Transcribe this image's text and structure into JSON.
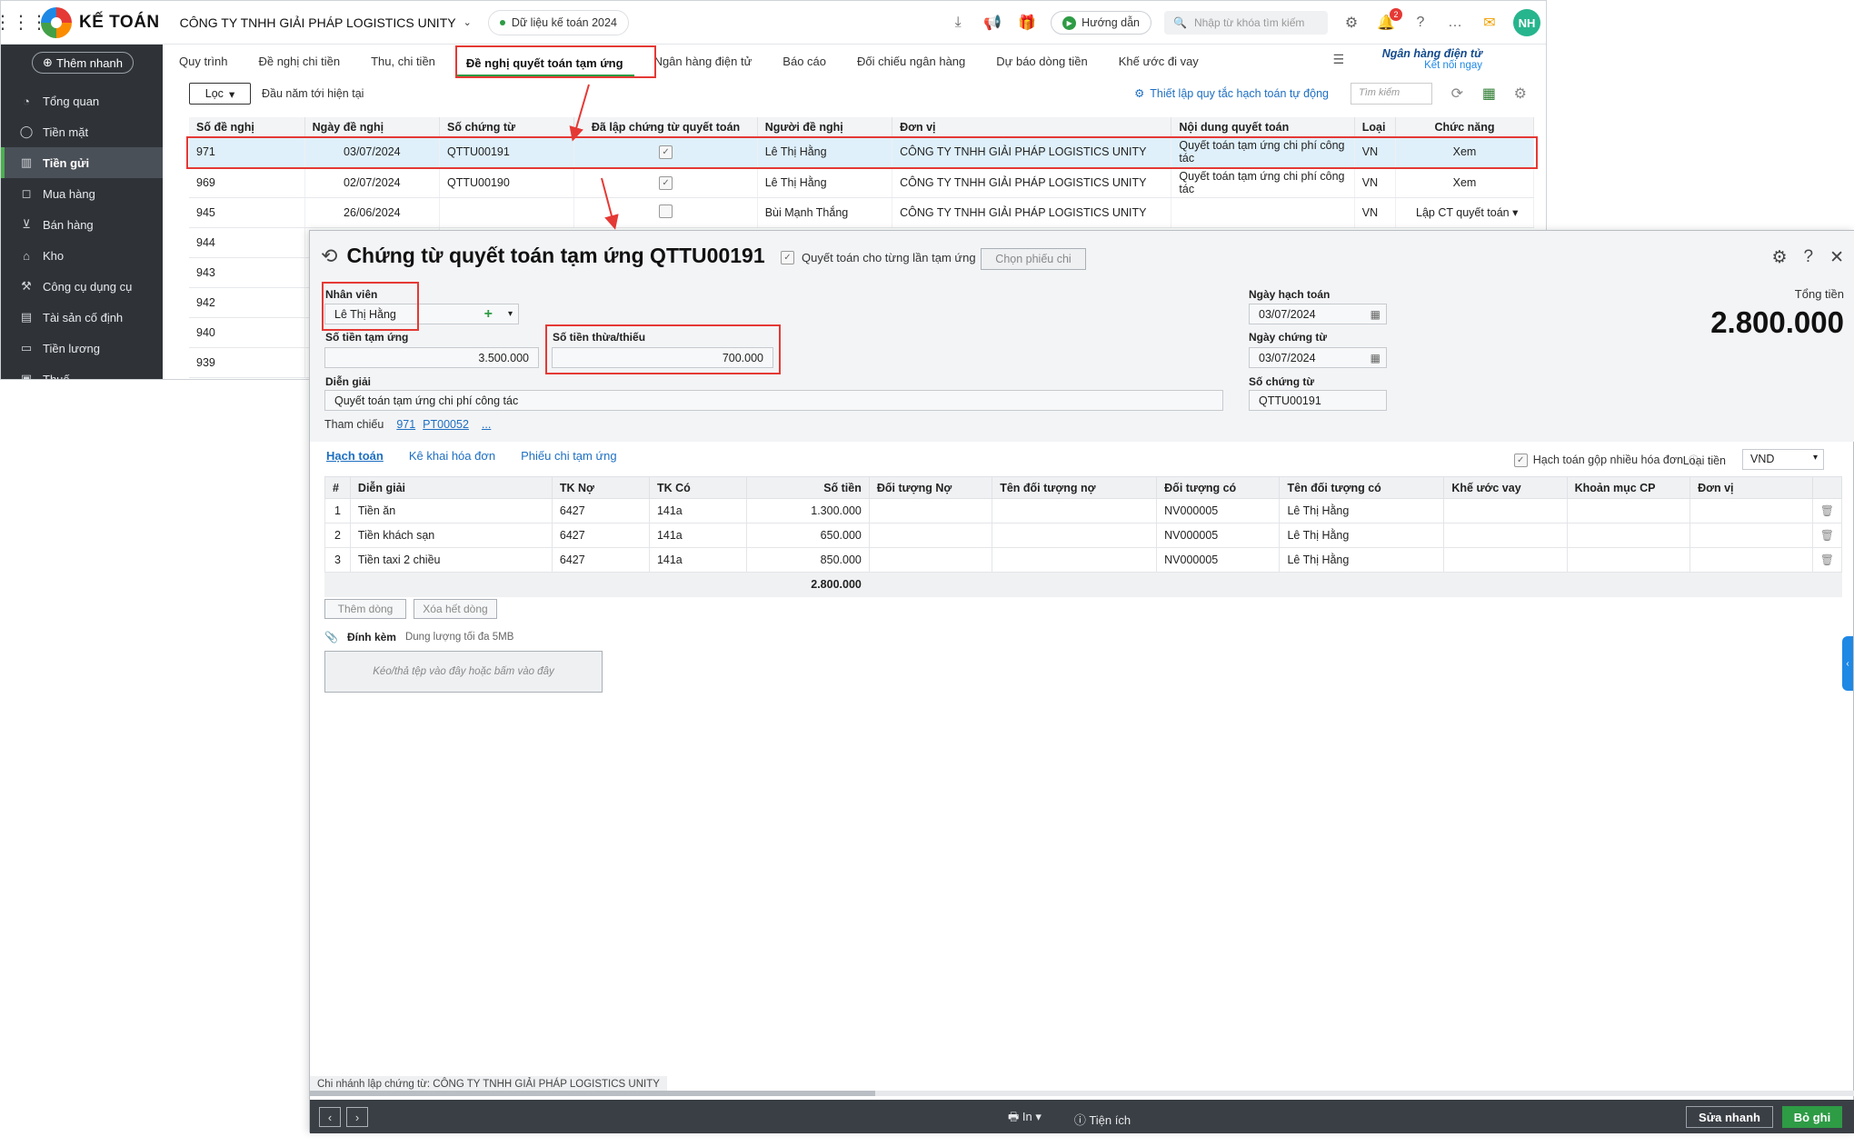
{
  "app": {
    "logo_text": "KẾ TOÁN",
    "company": "CÔNG TY TNHH GIẢI PHÁP LOGISTICS UNITY",
    "data_year": "Dữ liệu kế toán 2024",
    "guide": "Hướng dẫn",
    "search_placeholder": "Nhập từ khóa tìm kiếm",
    "notif_count": "2",
    "avatar": "NH"
  },
  "sidebar": {
    "quick_add": "Thêm nhanh",
    "items": [
      {
        "label": "Tổng quan",
        "icon": "dashboard-icon"
      },
      {
        "label": "Tiền mặt",
        "icon": "cash-icon"
      },
      {
        "label": "Tiền gửi",
        "icon": "bank-icon",
        "active": true
      },
      {
        "label": "Mua hàng",
        "icon": "bag-icon"
      },
      {
        "label": "Bán hàng",
        "icon": "cart-icon"
      },
      {
        "label": "Kho",
        "icon": "warehouse-icon"
      },
      {
        "label": "Công cụ dụng cụ",
        "icon": "tools-icon"
      },
      {
        "label": "Tài sản cố định",
        "icon": "asset-icon"
      },
      {
        "label": "Tiền lương",
        "icon": "salary-icon"
      },
      {
        "label": "Thuế",
        "icon": "tax-icon"
      }
    ]
  },
  "tabs": [
    "Quy trình",
    "Đề nghị chi tiền",
    "Thu, chi tiền",
    "Đề nghị quyết toán tạm ứng",
    "Ngân hàng điện tử",
    "Báo cáo",
    "Đối chiếu ngân hàng",
    "Dự báo dòng tiền",
    "Khế ước đi vay"
  ],
  "bank_link": {
    "title": "Ngân hàng điện tử",
    "sub": "Kết nối ngay"
  },
  "toolbar": {
    "filter": "Lọc",
    "period": "Đầu năm tới hiện tại",
    "auto_rule": "Thiết lập quy tắc hạch toán tự động",
    "search": "Tìm kiếm"
  },
  "list": {
    "headers": [
      "Số đề nghị",
      "Ngày đề nghị",
      "Số chứng từ",
      "Đã lập chứng từ quyết toán",
      "Người đề nghị",
      "Đơn vị",
      "Nội dung quyết toán",
      "Loại",
      "Chức năng"
    ],
    "rows": [
      {
        "no": "971",
        "date": "03/07/2024",
        "doc": "QTTU00191",
        "done": true,
        "person": "Lê Thị Hằng",
        "unit": "CÔNG TY TNHH GIẢI PHÁP LOGISTICS UNITY",
        "content": "Quyết toán tạm ứng chi phí công tác",
        "type": "VN",
        "action": "Xem"
      },
      {
        "no": "969",
        "date": "02/07/2024",
        "doc": "QTTU00190",
        "done": true,
        "person": "Lê Thị Hằng",
        "unit": "CÔNG TY TNHH GIẢI PHÁP LOGISTICS UNITY",
        "content": "Quyết toán tạm ứng chi phí công tác",
        "type": "VN",
        "action": "Xem"
      },
      {
        "no": "945",
        "date": "26/06/2024",
        "doc": "",
        "done": false,
        "person": "Bùi Mạnh Thắng",
        "unit": "CÔNG TY TNHH GIẢI PHÁP LOGISTICS UNITY",
        "content": "",
        "type": "VN",
        "action": "Lập CT quyết toán"
      },
      {
        "no": "944"
      },
      {
        "no": "943"
      },
      {
        "no": "942"
      },
      {
        "no": "940"
      },
      {
        "no": "939"
      }
    ]
  },
  "dialog": {
    "title": "Chứng từ quyết toán tạm ứng QTTU00191",
    "per_advance": "Quyết toán cho từng lần tạm ứng",
    "choose_btn": "Chọn phiếu chi",
    "employee_label": "Nhân viên",
    "employee": "Lê Thị Hằng",
    "advance_label": "Số tiền tạm ứng",
    "advance": "3.500.000",
    "diff_label": "Số tiền thừa/thiếu",
    "diff": "700.000",
    "desc_label": "Diễn giải",
    "desc": "Quyết toán tạm ứng chi phí công tác",
    "ref_label": "Tham chiếu",
    "refs": [
      "971",
      "PT00052",
      "..."
    ],
    "post_date_label": "Ngày hạch toán",
    "post_date": "03/07/2024",
    "doc_date_label": "Ngày chứng từ",
    "doc_date": "03/07/2024",
    "doc_no_label": "Số chứng từ",
    "doc_no": "QTTU00191",
    "total_label": "Tổng tiền",
    "total": "2.800.000",
    "subtabs": [
      "Hạch toán",
      "Kê khai hóa đơn",
      "Phiếu chi tạm ứng"
    ],
    "merge_label": "Hạch toán gộp nhiều hóa đơn",
    "currency_label": "Loại tiền",
    "currency": "VND",
    "detail_headers": [
      "#",
      "Diễn giải",
      "TK Nợ",
      "TK Có",
      "Số tiền",
      "Đối tượng Nợ",
      "Tên đối tượng nợ",
      "Đối tượng có",
      "Tên đối tượng có",
      "Khế ước vay",
      "Khoản mục CP",
      "Đơn vị"
    ],
    "detail_rows": [
      {
        "no": "1",
        "desc": "Tiền ăn",
        "debit": "6427",
        "credit": "141a",
        "amount": "1.300.000",
        "obj_c": "NV000005",
        "obj_c_name": "Lê Thị Hằng"
      },
      {
        "no": "2",
        "desc": "Tiền khách sạn",
        "debit": "6427",
        "credit": "141a",
        "amount": "650.000",
        "obj_c": "NV000005",
        "obj_c_name": "Lê Thị Hằng"
      },
      {
        "no": "3",
        "desc": "Tiền taxi 2 chiều",
        "debit": "6427",
        "credit": "141a",
        "amount": "850.000",
        "obj_c": "NV000005",
        "obj_c_name": "Lê Thị Hằng"
      }
    ],
    "detail_total": "2.800.000",
    "add_row": "Thêm dòng",
    "clear_rows": "Xóa hết dòng",
    "attach_label": "Đính kèm",
    "attach_limit": "Dung lượng tối đa 5MB",
    "dropzone": "Kéo/thả tệp vào đây hoặc bấm vào đây",
    "branch": "Chi nhánh lập chứng từ: CÔNG TY TNHH GIẢI PHÁP LOGISTICS UNITY",
    "print": "In",
    "utility": "Tiện ích",
    "quick_edit": "Sửa nhanh",
    "save": "Bỏ ghi"
  }
}
